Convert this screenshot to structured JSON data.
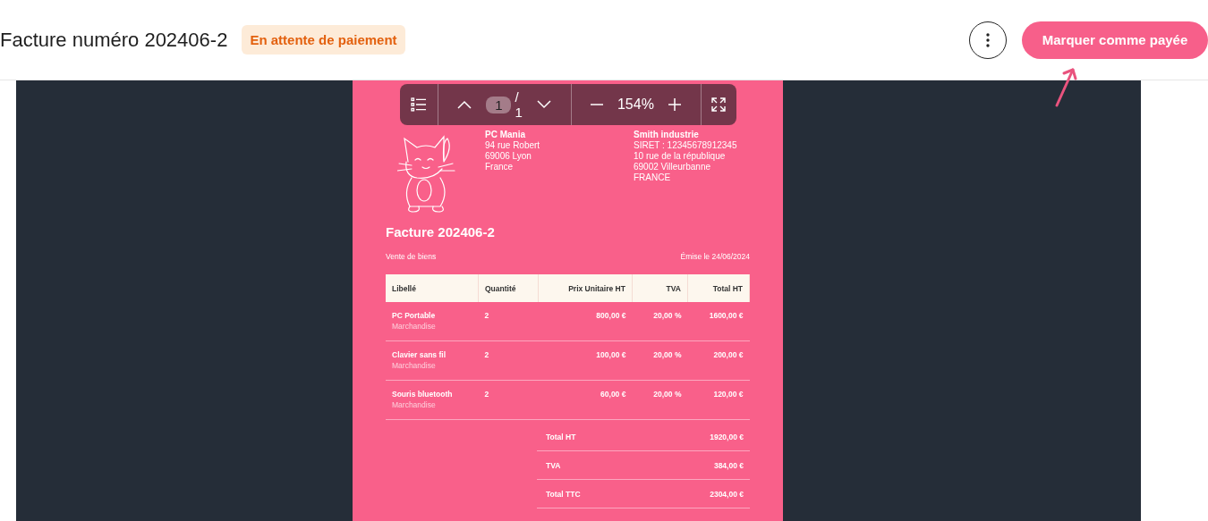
{
  "header": {
    "title": "Facture numéro 202406-2",
    "status_badge": "En attente de paiement",
    "primary_button": "Marquer comme payée"
  },
  "viewer_toolbar": {
    "current_page": "1",
    "page_total": "/ 1",
    "zoom": "154%"
  },
  "invoice": {
    "sender": {
      "name": "PC Mania",
      "lines": [
        "94 rue Robert",
        "69006  Lyon",
        "France"
      ]
    },
    "recipient": {
      "name": "Smith industrie",
      "lines": [
        "SIRET : 12345678912345",
        "10 rue de la république",
        "69002  Villeurbanne",
        "FRANCE"
      ]
    },
    "title": "Facture 202406-2",
    "subtitle": "Vente de biens",
    "issued": "Émise le 24/06/2024",
    "columns": [
      "Libellé",
      "Quantité",
      "Prix Unitaire HT",
      "TVA",
      "Total HT"
    ],
    "rows": [
      {
        "label": "PC Portable",
        "category": "Marchandise",
        "quantity": "2",
        "unit_price": "800,00 €",
        "vat": "20,00 %",
        "total": "1600,00 €"
      },
      {
        "label": "Clavier sans fil",
        "category": "Marchandise",
        "quantity": "2",
        "unit_price": "100,00 €",
        "vat": "20,00 %",
        "total": "200,00 €"
      },
      {
        "label": "Souris bluetooth",
        "category": "Marchandise",
        "quantity": "2",
        "unit_price": "60,00 €",
        "vat": "20,00 %",
        "total": "120,00 €"
      }
    ],
    "totals": [
      {
        "label": "Total HT",
        "value": "1920,00 €"
      },
      {
        "label": "TVA",
        "value": "384,00 €"
      },
      {
        "label": "Total TTC",
        "value": "2304,00 €"
      }
    ]
  }
}
